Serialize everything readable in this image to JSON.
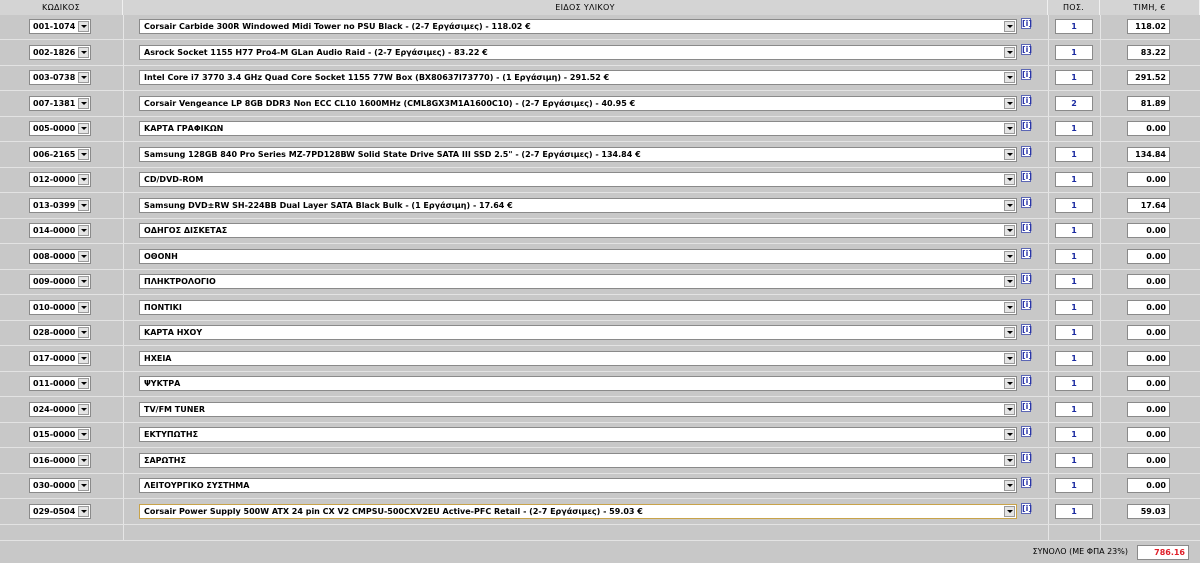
{
  "headers": {
    "code": "ΚΩΔΙΚΟΣ",
    "item": "ΕΙΔΟΣ ΥΛΙΚΟΥ",
    "qty": "ΠΟΣ.",
    "price": "ΤΙΜΗ, €"
  },
  "info_label": "[i]",
  "rows": [
    {
      "code": "001-1074",
      "item": "Corsair Carbide 300R Windowed Midi Tower no PSU Black - (2-7 Εργάσιμες) - 118.02 €",
      "qty": "1",
      "price": "118.02"
    },
    {
      "code": "002-1826",
      "item": "Asrock Socket 1155 H77 Pro4-M GLan Audio Raid - (2-7 Εργάσιμες) - 83.22 €",
      "qty": "1",
      "price": "83.22"
    },
    {
      "code": "003-0738",
      "item": "Intel Core i7 3770 3.4 GHz Quad Core Socket 1155 77W Box (BX80637I73770) - (1 Εργάσιμη) - 291.52 €",
      "qty": "1",
      "price": "291.52"
    },
    {
      "code": "007-1381",
      "item": "Corsair Vengeance LP 8GB DDR3 Non ECC CL10 1600MHz (CML8GX3M1A1600C10) - (2-7 Εργάσιμες) - 40.95 €",
      "qty": "2",
      "price": "81.89"
    },
    {
      "code": "005-0000",
      "item": "ΚΑΡΤΑ ΓΡΑΦΙΚΩΝ",
      "qty": "1",
      "price": "0.00"
    },
    {
      "code": "006-2165",
      "item": "Samsung 128GB 840 Pro Series MZ-7PD128BW Solid State Drive SATA III SSD 2.5\" - (2-7 Εργάσιμες) - 134.84 €",
      "qty": "1",
      "price": "134.84"
    },
    {
      "code": "012-0000",
      "item": "CD/DVD-ROM",
      "qty": "1",
      "price": "0.00"
    },
    {
      "code": "013-0399",
      "item": "Samsung DVD±RW SH-224BB Dual Layer SATA Black Bulk - (1 Εργάσιμη) - 17.64 €",
      "qty": "1",
      "price": "17.64"
    },
    {
      "code": "014-0000",
      "item": "ΟΔΗΓΟΣ ΔΙΣΚΕΤΑΣ",
      "qty": "1",
      "price": "0.00"
    },
    {
      "code": "008-0000",
      "item": "ΟΘΟΝΗ",
      "qty": "1",
      "price": "0.00"
    },
    {
      "code": "009-0000",
      "item": "ΠΛΗΚΤΡΟΛΟΓΙΟ",
      "qty": "1",
      "price": "0.00"
    },
    {
      "code": "010-0000",
      "item": "ΠΟΝΤΙΚΙ",
      "qty": "1",
      "price": "0.00"
    },
    {
      "code": "028-0000",
      "item": "ΚΑΡΤΑ ΗΧΟΥ",
      "qty": "1",
      "price": "0.00"
    },
    {
      "code": "017-0000",
      "item": "ΗΧΕΙΑ",
      "qty": "1",
      "price": "0.00"
    },
    {
      "code": "011-0000",
      "item": "ΨΥΚΤΡΑ",
      "qty": "1",
      "price": "0.00"
    },
    {
      "code": "024-0000",
      "item": "TV/FM TUNER",
      "qty": "1",
      "price": "0.00"
    },
    {
      "code": "015-0000",
      "item": "ΕΚΤΥΠΩΤΗΣ",
      "qty": "1",
      "price": "0.00"
    },
    {
      "code": "016-0000",
      "item": "ΣΑΡΩΤΗΣ",
      "qty": "1",
      "price": "0.00"
    },
    {
      "code": "030-0000",
      "item": "ΛΕΙΤΟΥΡΓΙΚΟ ΣΥΣΤΗΜΑ",
      "qty": "1",
      "price": "0.00"
    },
    {
      "code": "029-0504",
      "item": "Corsair Power Supply 500W ATX 24 pin CX V2 CMPSU-500CXV2EU Active-PFC Retail - (2-7 Εργάσιμες) - 59.03 €",
      "qty": "1",
      "price": "59.03",
      "selected": true
    }
  ],
  "footer": {
    "total_label": "ΣΥΝΟΛΟ (ΜΕ ΦΠΑ 23%)",
    "total_value": "786.16"
  },
  "colors": {
    "background": "#c8c8c8",
    "qty_text": "#1a2aa0",
    "total_text": "#e0202a",
    "selected_border": "#c8a34a"
  }
}
